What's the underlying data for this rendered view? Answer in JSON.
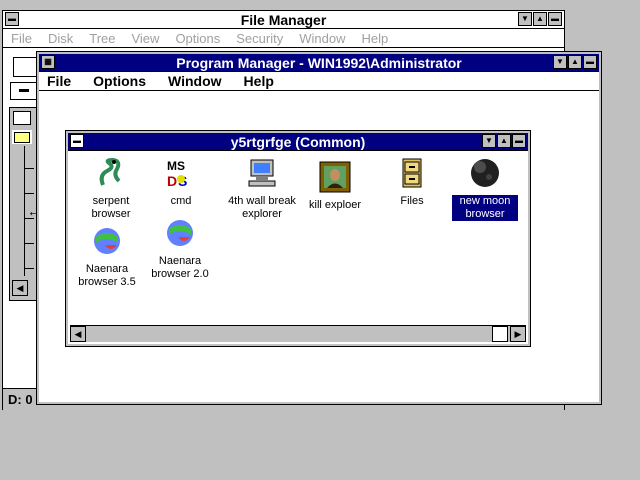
{
  "file_manager": {
    "title": "File Manager",
    "menu": [
      "File",
      "Disk",
      "Tree",
      "View",
      "Options",
      "Security",
      "Window",
      "Help"
    ],
    "status_drive": "D: 0"
  },
  "program_manager": {
    "title": "Program Manager - WIN1992\\Administrator",
    "menu": [
      "File",
      "Options",
      "Window",
      "Help"
    ]
  },
  "group_window": {
    "title": "y5rtgrfge (Common)",
    "icons": [
      {
        "label_lines": [
          "serpent",
          "browser"
        ],
        "icon": "serpent-icon",
        "selected": false
      },
      {
        "label_lines": [
          "cmd"
        ],
        "icon": "msdos-icon",
        "selected": false
      },
      {
        "label_lines": [
          "4th wall break",
          "explorer"
        ],
        "icon": "computer-icon",
        "selected": false
      },
      {
        "label_lines": [
          "kill exploer"
        ],
        "icon": "portrait-icon",
        "selected": false
      },
      {
        "label_lines": [
          "Files"
        ],
        "icon": "file-cabinet-icon",
        "selected": false
      },
      {
        "label_lines": [
          "new moon",
          "browser"
        ],
        "icon": "moon-icon",
        "selected": true
      },
      {
        "label_lines": [
          "Naenara",
          "browser 3.5"
        ],
        "icon": "globe-icon",
        "selected": false
      },
      {
        "label_lines": [
          "Naenara",
          "browser 2.0"
        ],
        "icon": "globe-icon",
        "selected": false
      }
    ]
  }
}
